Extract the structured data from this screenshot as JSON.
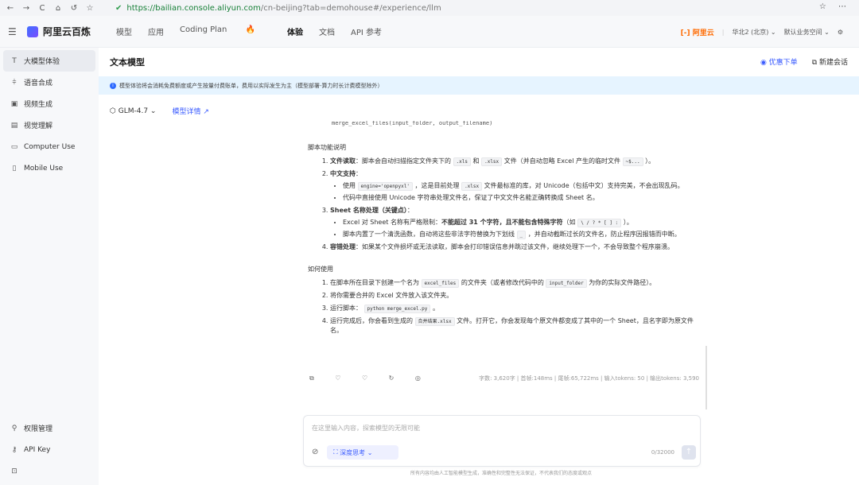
{
  "browser": {
    "nav_icons": [
      "←",
      "→",
      "C",
      "⌂",
      "↺",
      "☆"
    ],
    "url_host": "https://bailian.console.aliyun.com",
    "url_rest": "/cn-beijing?tab=demohouse#/experience/llm",
    "right_icons": "☆ ⋯"
  },
  "topnav": {
    "brand": "阿里云百炼",
    "menu": [
      "模型",
      "应用",
      "Coding Plan",
      "体验",
      "文档",
      "API 参考"
    ],
    "aliyun": "[-] 阿里云",
    "region": "华北2 (北京) ⌄",
    "workspace": "默认业务空间 ⌄",
    "gear": "⚙"
  },
  "sidebar": {
    "items": [
      {
        "icon": "T",
        "label": "大模型体验"
      },
      {
        "icon": "⫩",
        "label": "语音合成"
      },
      {
        "icon": "▣",
        "label": "视频生成"
      },
      {
        "icon": "▤",
        "label": "视觉理解"
      },
      {
        "icon": "▭",
        "label": "Computer Use"
      },
      {
        "icon": "▯",
        "label": "Mobile Use"
      }
    ],
    "bottom": [
      {
        "icon": "⚲",
        "label": "权限管理"
      },
      {
        "icon": "⚷",
        "label": "API Key"
      },
      {
        "icon": "⊡",
        "label": ""
      }
    ]
  },
  "main": {
    "title": "文本模型",
    "discount": "优惠下单",
    "new_chat": "新建会话",
    "notice": "模型体验将会消耗免费额度或产生按量付费账单，费用以实际发生为主（模型部署-算力时长计费模型除外）",
    "model": "GLM-4.7",
    "model_link": "模型详情 ↗"
  },
  "content": {
    "code_frag": "merge_excel_files(input_folder, output_filename)",
    "sec1": "脚本功能说明",
    "sec2": "如何使用",
    "p1_head": "文件读取",
    "p1_a": "：脚本会自动扫描指定文件夹下的",
    "p1_c1": ".xls",
    "p1_b": "和",
    "p1_c2": ".xlsx",
    "p1_c": "文件（并自动忽略 Excel 产生的临时文件",
    "p1_c3": "~$...",
    "p1_d": "）。",
    "p2_head": "中文支持",
    "p2_s1_a": "使用",
    "p2_s1_c1": "engine='openpyxl'",
    "p2_s1_b": "，这是目前处理",
    "p2_s1_c2": ".xlsx",
    "p2_s1_c": "文件最标准的库，对 Unicode（包括中文）支持完美，不会出现乱码。",
    "p2_s2": "代码中直接使用 Unicode 字符串处理文件名，保证了中文文件名能正确转换成 Sheet 名。",
    "p3_head": "Sheet 名称处理（关键点）",
    "p3_s1_a": "Excel 对 Sheet 名称有严格限制：",
    "p3_s1_b": "不能超过 31 个字符，且不能包含特殊字符",
    "p3_s1_c": "（如",
    "p3_s1_code": "\\ / ? * [ ] :",
    "p3_s1_d": "）。",
    "p3_s2_a": "脚本内置了一个清洗函数，自动将这些非法字符替换为下划线",
    "p3_s2_code": "_",
    "p3_s2_b": "，并自动截断过长的文件名，防止程序因报错而中断。",
    "p4_head": "容错处理",
    "p4": "：如果某个文件损坏或无法读取，脚本会打印错误信息并跳过该文件，继续处理下一个，不会导致整个程序崩溃。",
    "u1_a": "在脚本所在目录下创建一个名为",
    "u1_c1": "excel_files",
    "u1_b": "的文件夹（或者修改代码中的",
    "u1_c2": "input_folder",
    "u1_c": "为你的实际文件路径）。",
    "u2": "将你需要合并的 Excel 文件放入该文件夹。",
    "u3_a": "运行脚本：",
    "u3_code": "python merge_excel.py",
    "u3_b": "。",
    "u4_a": "运行完成后，你会看到生成的",
    "u4_code": "合并结果.xlsx",
    "u4_b": "文件。打开它，你会发现每个原文件都变成了其中的一个 Sheet，且名字即为原文件名。"
  },
  "meta": {
    "icons": "⧉ ♡ ♡ ↻ ◎",
    "stats": "字数: 3,620字 | 首帧:148ms | 尾帧:65,722ms | 输入tokens: 50 | 输出tokens: 3,590"
  },
  "input": {
    "placeholder": "在这里输入内容，探索模型的无限可能",
    "deep": "深度思考 ⌄",
    "count": "0/32000",
    "send": "↑"
  },
  "footer": "所有内容均由人工智能模型生成，准确性和完整性无法保证，不代表我们的态度或观点"
}
